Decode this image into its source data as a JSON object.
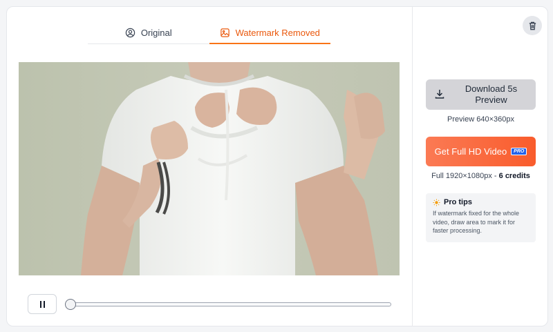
{
  "tabs": [
    {
      "label": "Original",
      "icon": "user-circle-icon",
      "active": false
    },
    {
      "label": "Watermark Removed",
      "icon": "image-icon",
      "active": true
    }
  ],
  "player": {
    "state": "playing",
    "progress": 0.0
  },
  "sidebar": {
    "download_label": "Download 5s Preview",
    "preview_caption": "Preview 640×360px",
    "hd_label": "Get Full HD Video",
    "pro_badge": "PRO",
    "full_caption_prefix": "Full 1920×1080px - ",
    "credits": "6 credits",
    "tips_title": "Pro tips",
    "tips_body": "If watermark fixed for the whole video, draw area to mark it for faster processing."
  },
  "colors": {
    "accent": "#ea580c",
    "hd_button": "#f95c2c",
    "pro_badge": "#2563eb"
  }
}
